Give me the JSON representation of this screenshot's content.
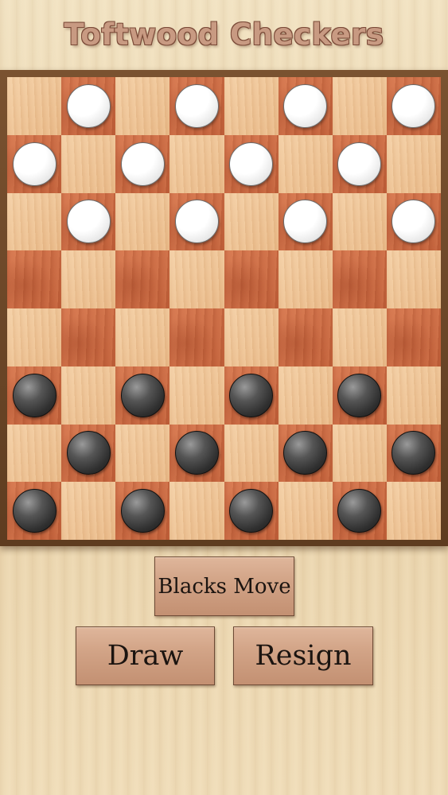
{
  "title": "Toftwood Checkers",
  "board": {
    "size": 8,
    "rows": [
      [
        "",
        "W",
        "",
        "W",
        "",
        "W",
        "",
        "W"
      ],
      [
        "W",
        "",
        "W",
        "",
        "W",
        "",
        "W",
        ""
      ],
      [
        "",
        "W",
        "",
        "W",
        "",
        "W",
        "",
        "W"
      ],
      [
        "",
        "",
        "",
        "",
        "",
        "",
        "",
        ""
      ],
      [
        "",
        "",
        "",
        "",
        "",
        "",
        "",
        ""
      ],
      [
        "B",
        "",
        "B",
        "",
        "B",
        "",
        "B",
        ""
      ],
      [
        "",
        "B",
        "",
        "B",
        "",
        "B",
        "",
        "B"
      ],
      [
        "B",
        "",
        "B",
        "",
        "B",
        "",
        "B",
        ""
      ]
    ]
  },
  "status": "Blacks Move",
  "buttons": {
    "draw": "Draw",
    "resign": "Resign"
  },
  "colors": {
    "light_square": "#eec79c",
    "dark_square": "#c8663f",
    "frame": "#6b4527",
    "white_piece": "#ffffff",
    "black_piece": "#2f2f2f",
    "title": "#c89a82"
  }
}
